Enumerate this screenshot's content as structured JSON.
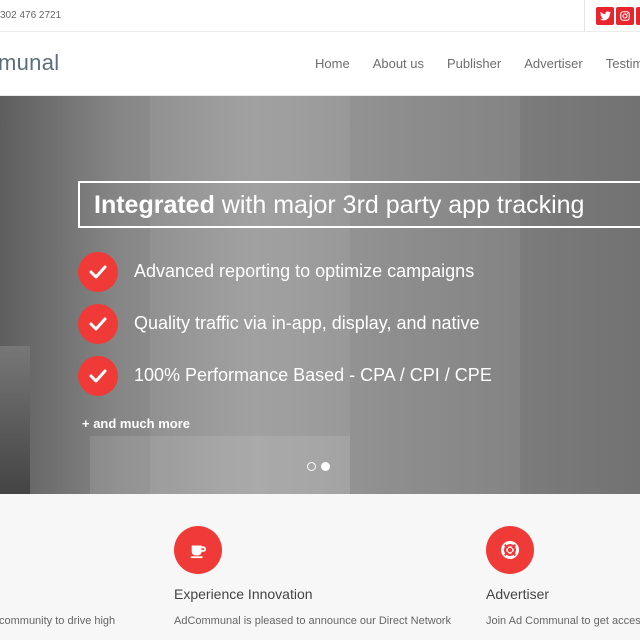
{
  "topbar": {
    "phone": "302 476 2721",
    "social": [
      {
        "icon": "twitter-icon",
        "color": "#e8242c"
      },
      {
        "icon": "instagram-icon",
        "color": "#e8242c"
      },
      {
        "icon": "social-icon",
        "color": "#e8242c"
      }
    ]
  },
  "header": {
    "logo_text": "munal",
    "nav": [
      "Home",
      "About us",
      "Publisher",
      "Advertiser",
      "Testim"
    ]
  },
  "hero": {
    "headline_bold": "Integrated",
    "headline_rest": " with major 3rd party app tracking",
    "features": [
      "Advanced reporting to optimize campaigns",
      "Quality traffic via in-app, display, and native",
      "100% Performance Based - CPA / CPI / CPE"
    ],
    "more": "+ and much more",
    "slides": {
      "count": 2,
      "active": 2
    }
  },
  "services": {
    "col1_text": "community to drive high",
    "col2": {
      "title": "Experience Innovation",
      "text": "AdCommunal is pleased to announce our Direct Network",
      "icon": "cup-icon"
    },
    "col3": {
      "title": "Advertiser",
      "text": "Join Ad Communal to get acces",
      "icon": "lifebuoy-icon"
    }
  },
  "colors": {
    "accent": "#ef3a38",
    "logo": "#5b6d7b"
  }
}
